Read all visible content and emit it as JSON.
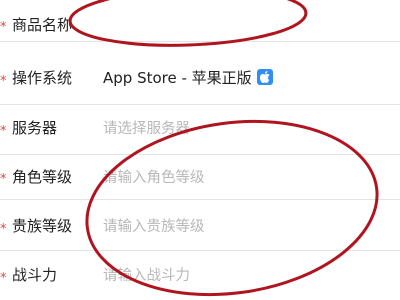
{
  "form": {
    "rows": [
      {
        "required_mark": "*",
        "label": "商品名称",
        "value": ""
      },
      {
        "required_mark": "*",
        "label": "操作系统",
        "value": "App Store - 苹果正版",
        "badge_icon": "apple-icon",
        "badge_color": "#2f8ff5"
      },
      {
        "required_mark": "*",
        "label": "服务器",
        "placeholder": "请选择服务器"
      },
      {
        "required_mark": "*",
        "label": "角色等级",
        "placeholder": "请输入角色等级"
      },
      {
        "required_mark": "*",
        "label": "贵族等级",
        "placeholder": "请输入贵族等级"
      },
      {
        "required_mark": "*",
        "label": "战斗力",
        "placeholder": "请输入战斗力"
      }
    ]
  },
  "annotation": {
    "color": "#b0141e",
    "shapes": [
      "ellipse",
      "ellipse"
    ]
  }
}
